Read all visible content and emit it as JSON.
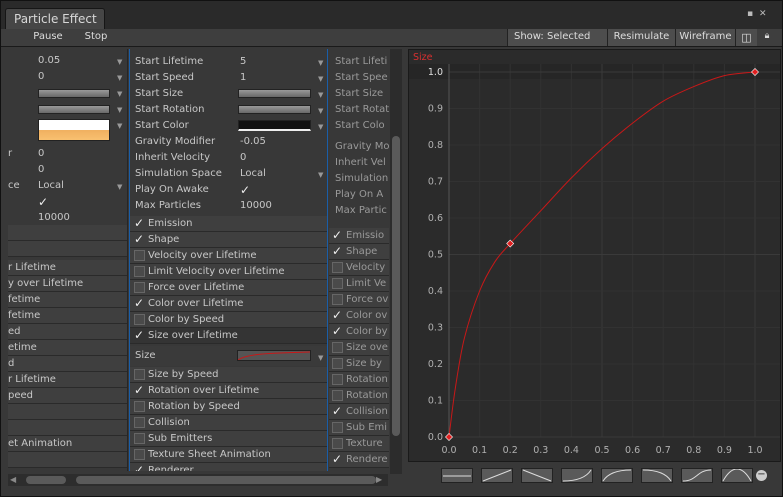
{
  "window": {
    "tab_title": "Particle Effect"
  },
  "toolbar": {
    "pause": "Pause",
    "stop": "Stop",
    "show_selected": "Show: Selected",
    "resimulate": "Resimulate",
    "wireframe": "Wireframe"
  },
  "left_column": {
    "values": [
      "0.05",
      "0",
      "0",
      "0",
      "Local",
      "10000"
    ],
    "labels": [
      "r",
      "ce"
    ],
    "modules": [
      "r Lifetime",
      "y over Lifetime",
      "fetime",
      "fetime",
      "ed",
      "etime",
      "d",
      "r Lifetime",
      "peed",
      "et Animation"
    ]
  },
  "main_column": {
    "props": [
      {
        "label": "Start Lifetime",
        "value": "5"
      },
      {
        "label": "Start Speed",
        "value": "1"
      },
      {
        "label": "Start Size",
        "value": ""
      },
      {
        "label": "Start Rotation",
        "value": ""
      },
      {
        "label": "Start Color",
        "value": ""
      },
      {
        "label": "Gravity Modifier",
        "value": "-0.05"
      },
      {
        "label": "Inherit Velocity",
        "value": "0"
      },
      {
        "label": "Simulation Space",
        "value": "Local"
      },
      {
        "label": "Play On Awake",
        "value": "✓"
      },
      {
        "label": "Max Particles",
        "value": "10000"
      }
    ],
    "modules": [
      {
        "label": "Emission",
        "checked": true
      },
      {
        "label": "Shape",
        "checked": true
      },
      {
        "label": "Velocity over Lifetime",
        "checked": false
      },
      {
        "label": "Limit Velocity over Lifetime",
        "checked": false
      },
      {
        "label": "Force over Lifetime",
        "checked": false
      },
      {
        "label": "Color over Lifetime",
        "checked": true
      },
      {
        "label": "Color by Speed",
        "checked": false
      },
      {
        "label": "Size over Lifetime",
        "checked": true
      }
    ],
    "size_label": "Size",
    "modules2": [
      {
        "label": "Size by Speed",
        "checked": false
      },
      {
        "label": "Rotation over Lifetime",
        "checked": true
      },
      {
        "label": "Rotation by Speed",
        "checked": false
      },
      {
        "label": "Collision",
        "checked": false
      },
      {
        "label": "Sub Emitters",
        "checked": false
      },
      {
        "label": "Texture Sheet Animation",
        "checked": false
      },
      {
        "label": "Renderer",
        "checked": true
      }
    ]
  },
  "right_column": {
    "props": [
      "Start Lifeti",
      "Start Spee",
      "Start Size",
      "Start Rotat",
      "Start Colo",
      "Gravity Mo",
      "Inherit Vel",
      "Simulation",
      "Play On A",
      "Max Partic"
    ],
    "modules": [
      {
        "label": "Emissio",
        "checked": true
      },
      {
        "label": "Shape",
        "checked": true
      },
      {
        "label": "Velocity",
        "checked": false
      },
      {
        "label": "Limit Ve",
        "checked": false
      },
      {
        "label": "Force ov",
        "checked": false
      },
      {
        "label": "Color ov",
        "checked": true
      },
      {
        "label": "Color by",
        "checked": true
      },
      {
        "label": "Size ove",
        "checked": false
      },
      {
        "label": "Size by",
        "checked": false
      },
      {
        "label": "Rotation",
        "checked": false
      },
      {
        "label": "Rotation",
        "checked": false
      },
      {
        "label": "Collision",
        "checked": true
      },
      {
        "label": "Sub Emi",
        "checked": false
      },
      {
        "label": "Texture",
        "checked": false
      },
      {
        "label": "Rendere",
        "checked": true
      }
    ]
  },
  "chart_data": {
    "type": "line",
    "title": "Size",
    "xlim": [
      0.0,
      1.0
    ],
    "ylim": [
      0.0,
      1.0
    ],
    "x_ticks": [
      "0.0",
      "0.1",
      "0.2",
      "0.3",
      "0.4",
      "0.5",
      "0.6",
      "0.7",
      "0.8",
      "0.9",
      "1.0"
    ],
    "y_ticks": [
      "0.0",
      "0.1",
      "0.2",
      "0.3",
      "0.4",
      "0.5",
      "0.6",
      "0.7",
      "0.8",
      "0.9",
      "1.0"
    ],
    "keys": [
      {
        "x": 0.0,
        "y": 0.0
      },
      {
        "x": 0.2,
        "y": 0.53
      },
      {
        "x": 1.0,
        "y": 1.0
      }
    ],
    "curve": [
      {
        "x": 0.0,
        "y": 0.0
      },
      {
        "x": 0.02,
        "y": 0.13
      },
      {
        "x": 0.05,
        "y": 0.27
      },
      {
        "x": 0.1,
        "y": 0.4
      },
      {
        "x": 0.15,
        "y": 0.48
      },
      {
        "x": 0.2,
        "y": 0.53
      },
      {
        "x": 0.3,
        "y": 0.62
      },
      {
        "x": 0.4,
        "y": 0.71
      },
      {
        "x": 0.5,
        "y": 0.79
      },
      {
        "x": 0.6,
        "y": 0.86
      },
      {
        "x": 0.7,
        "y": 0.92
      },
      {
        "x": 0.8,
        "y": 0.96
      },
      {
        "x": 0.9,
        "y": 0.99
      },
      {
        "x": 1.0,
        "y": 1.0
      }
    ],
    "curve_color": "#c81818",
    "grid": true
  }
}
